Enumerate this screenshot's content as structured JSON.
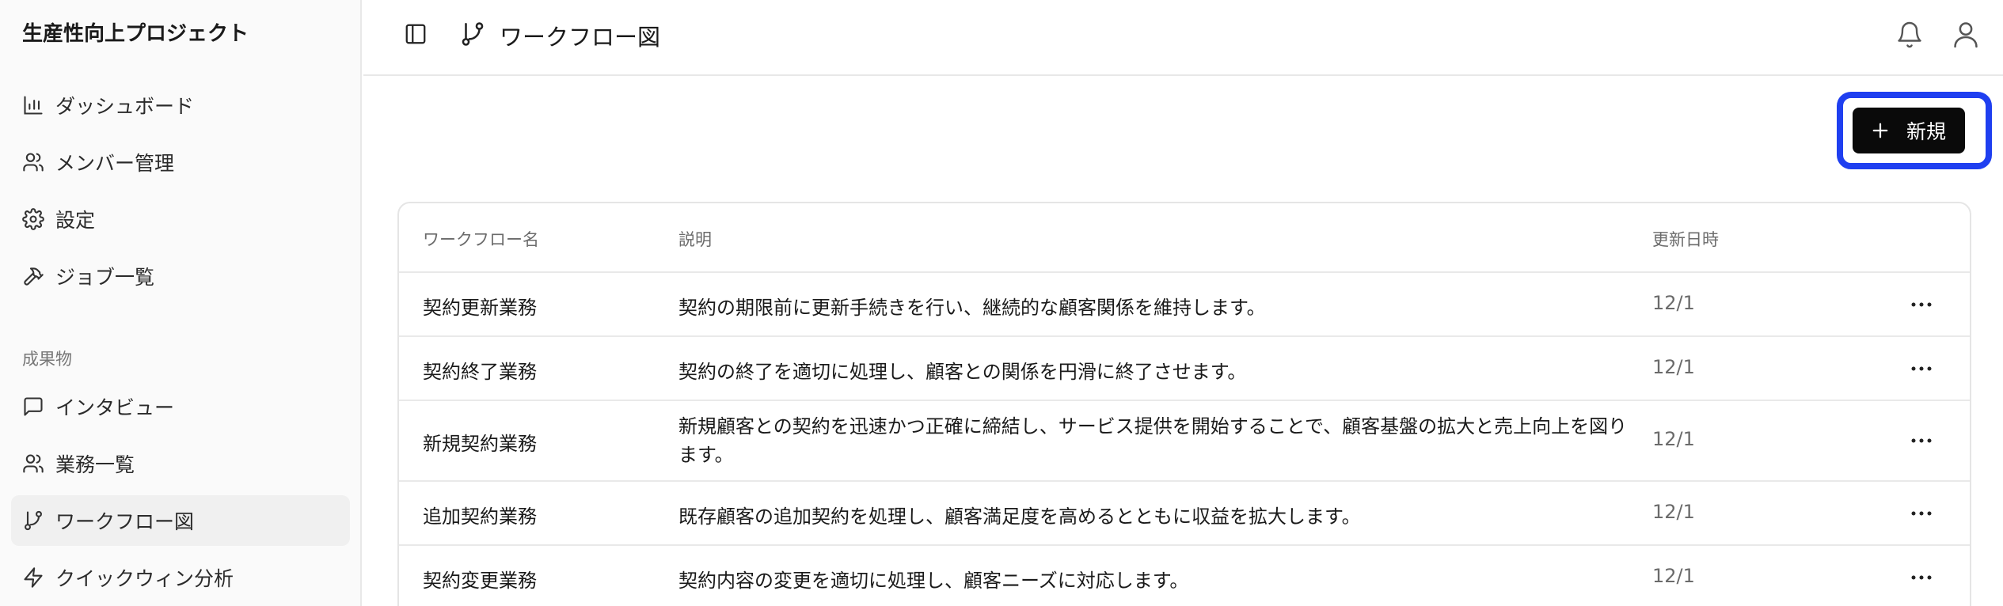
{
  "sidebar": {
    "project_title": "生産性向上プロジェクト",
    "items": [
      {
        "label": "ダッシュボード",
        "icon": "bar-chart-icon"
      },
      {
        "label": "メンバー管理",
        "icon": "users-icon"
      },
      {
        "label": "設定",
        "icon": "gear-icon"
      },
      {
        "label": "ジョブ一覧",
        "icon": "hammer-icon"
      }
    ],
    "section_label": "成果物",
    "deliverables": [
      {
        "label": "インタビュー",
        "icon": "message-square-icon"
      },
      {
        "label": "業務一覧",
        "icon": "users-icon"
      },
      {
        "label": "ワークフロー図",
        "icon": "git-branch-icon",
        "active": true
      },
      {
        "label": "クイックウィン分析",
        "icon": "zap-icon"
      }
    ]
  },
  "header": {
    "title": "ワークフロー図",
    "icons": [
      "sidebar-toggle-icon",
      "git-branch-icon",
      "bell-icon",
      "user-icon"
    ]
  },
  "toolbar": {
    "new_label": "新規",
    "highlight_color": "#1f3ff0"
  },
  "table": {
    "columns": [
      "ワークフロー名",
      "説明",
      "更新日時"
    ],
    "rows": [
      {
        "name": "契約更新業務",
        "description": "契約の期限前に更新手続きを行い、継続的な顧客関係を維持します。",
        "updated": "12/1"
      },
      {
        "name": "契約終了業務",
        "description": "契約の終了を適切に処理し、顧客との関係を円滑に終了させます。",
        "updated": "12/1"
      },
      {
        "name": "新規契約業務",
        "description": "新規顧客との契約を迅速かつ正確に締結し、サービス提供を開始することで、顧客基盤の拡大と売上向上を図ります。",
        "updated": "12/1"
      },
      {
        "name": "追加契約業務",
        "description": "既存顧客の追加契約を処理し、顧客満足度を高めるとともに収益を拡大します。",
        "updated": "12/1"
      },
      {
        "name": "契約変更業務",
        "description": "契約内容の変更を適切に処理し、顧客ニーズに対応します。",
        "updated": "12/1"
      }
    ]
  }
}
